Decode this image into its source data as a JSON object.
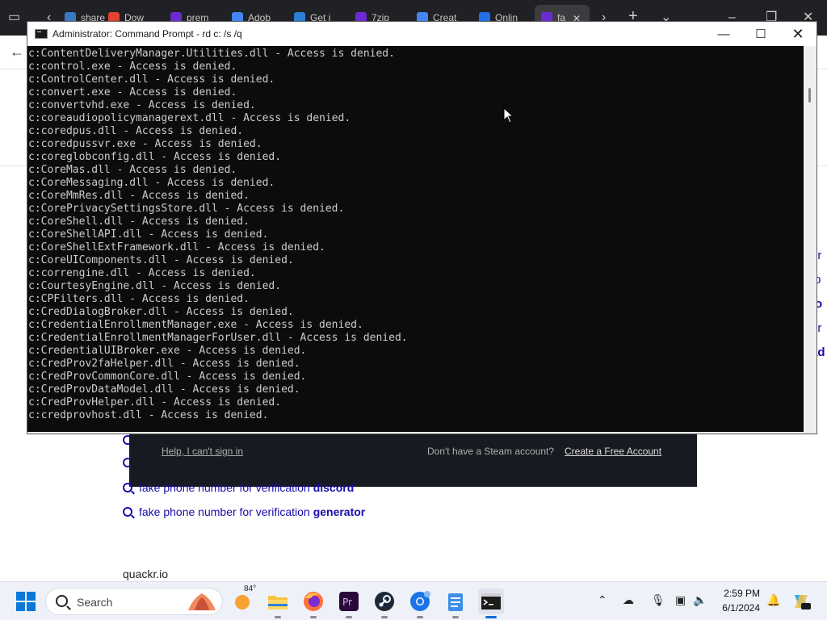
{
  "browser": {
    "tabs": [
      {
        "label": "share",
        "color": "#3a78c2"
      },
      {
        "label": "Dow",
        "color": "#e34133"
      },
      {
        "label": "prem",
        "color": "#6b2bd1"
      },
      {
        "label": "Adob",
        "color": "#4285f4"
      },
      {
        "label": "Get i",
        "color": "#2a7fd4"
      },
      {
        "label": "7zip",
        "color": "#6b2bd1"
      },
      {
        "label": "Creat",
        "color": "#4285f4"
      },
      {
        "label": "Onlin",
        "color": "#1f6fe5"
      },
      {
        "label": "fa",
        "color": "#6b2bd1"
      }
    ],
    "right_fragments": [
      "er",
      "fo",
      "to",
      "er",
      "ad"
    ],
    "suggestions": [
      {
        "prefix": "fake phone number for verification",
        "bold": "discord"
      },
      {
        "prefix": "fake phone number for verification",
        "bold": "generator"
      }
    ],
    "site_label": "quackr.io",
    "steam": {
      "help_link": "Help, I can't sign in",
      "no_account": "Don't have a Steam account?",
      "create_link": "Create a Free Account"
    }
  },
  "cmd": {
    "title": "Administrator: Command Prompt - rd  c: /s /q",
    "lines": [
      "c:ContentDeliveryManager.Utilities.dll - Access is denied.",
      "c:control.exe - Access is denied.",
      "c:ControlCenter.dll - Access is denied.",
      "c:convert.exe - Access is denied.",
      "c:convertvhd.exe - Access is denied.",
      "c:coreaudiopolicymanagerext.dll - Access is denied.",
      "c:coredpus.dll - Access is denied.",
      "c:coredpussvr.exe - Access is denied.",
      "c:coreglobconfig.dll - Access is denied.",
      "c:CoreMas.dll - Access is denied.",
      "c:CoreMessaging.dll - Access is denied.",
      "c:CoreMmRes.dll - Access is denied.",
      "c:CorePrivacySettingsStore.dll - Access is denied.",
      "c:CoreShell.dll - Access is denied.",
      "c:CoreShellAPI.dll - Access is denied.",
      "c:CoreShellExtFramework.dll - Access is denied.",
      "c:CoreUIComponents.dll - Access is denied.",
      "c:correngine.dll - Access is denied.",
      "c:CourtesyEngine.dll - Access is denied.",
      "c:CPFilters.dll - Access is denied.",
      "c:CredDialogBroker.dll - Access is denied.",
      "c:CredentialEnrollmentManager.exe - Access is denied.",
      "c:CredentialEnrollmentManagerForUser.dll - Access is denied.",
      "c:CredentialUIBroker.exe - Access is denied.",
      "c:CredProv2faHelper.dll - Access is denied.",
      "c:CredProvCommonCore.dll - Access is denied.",
      "c:CredProvDataModel.dll - Access is denied.",
      "c:CredProvHelper.dll - Access is denied.",
      "c:credprovhost.dll - Access is denied."
    ]
  },
  "taskbar": {
    "search_placeholder": "Search",
    "weather_temp": "84°",
    "time": "2:59 PM",
    "date": "6/1/2024"
  }
}
